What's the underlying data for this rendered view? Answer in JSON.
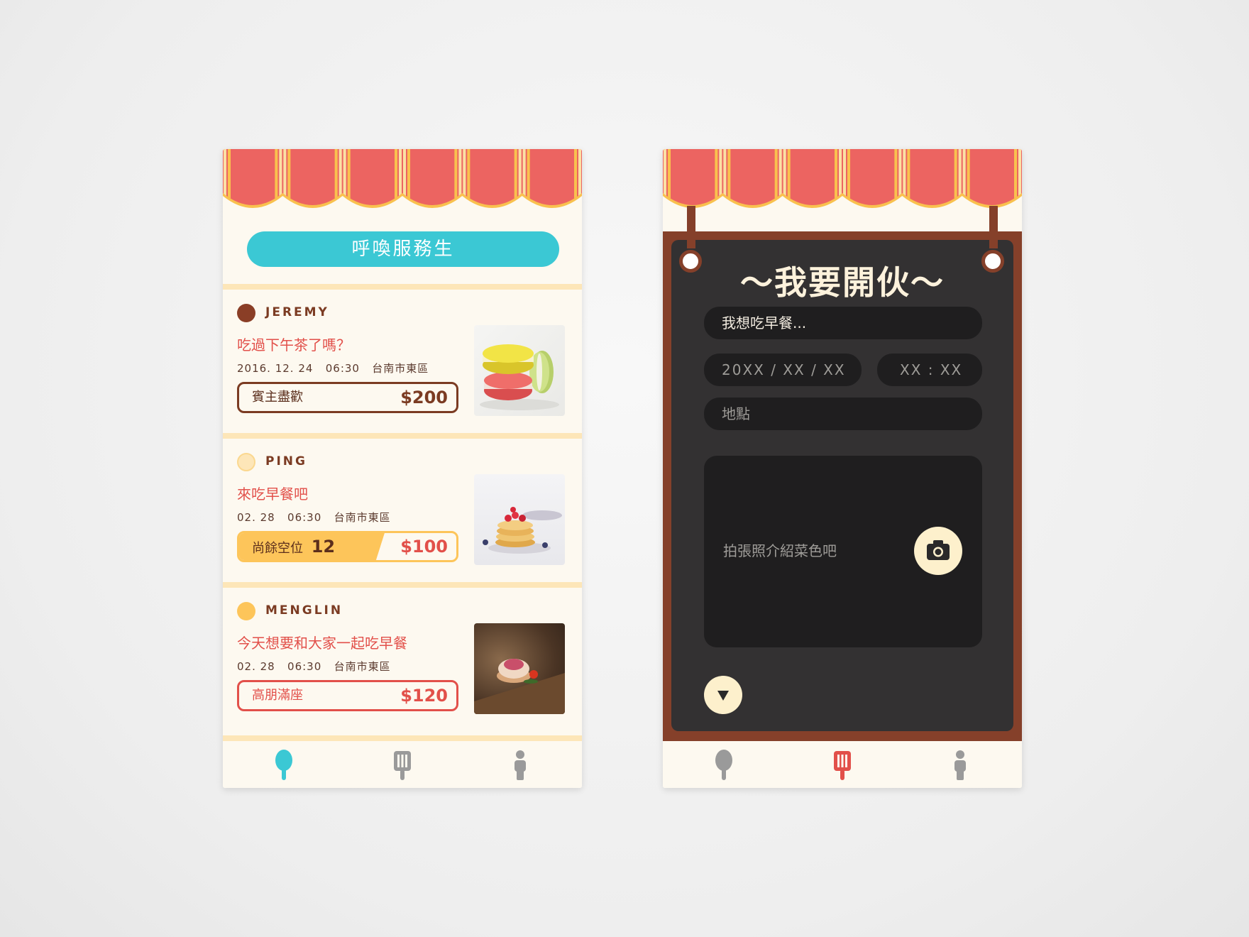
{
  "colors": {
    "awning_red": "#ec6461",
    "awning_stripe": "#fbe0a4",
    "awning_edge": "#f9c14e",
    "call_button": "#3bc8d4",
    "cream": "#fdf9f0",
    "brown": "#85402a",
    "board": "#333132",
    "accent_red": "#e2504a",
    "accent_yellow": "#fdc55a"
  },
  "left": {
    "call_button": "呼喚服務生",
    "posts": [
      {
        "user": "JEREMY",
        "avatar_color": "#8a3e26",
        "title": "吃過下午茶了嗎？",
        "date": "2016. 12. 24",
        "time": "06:30",
        "location": "台南市東區",
        "status": "賓主盡歡",
        "price": "$200",
        "photo": "macarons"
      },
      {
        "user": "PING",
        "avatar_color": "#fde6b8",
        "title": "來吃早餐吧",
        "date": "02. 28",
        "time": "06:30",
        "location": "台南市東區",
        "status": "尚餘空位",
        "seats": "12",
        "seats_fill": 0.65,
        "price": "$100",
        "photo": "pancakes"
      },
      {
        "user": "MENGLIN",
        "avatar_color": "#fdc55a",
        "title": "今天想要和大家一起吃早餐",
        "date": "02. 28",
        "time": "06:30",
        "location": "台南市東區",
        "status": "高朋滿座",
        "price": "$120",
        "photo": "tart"
      }
    ],
    "tabs": [
      {
        "icon": "spoon-icon",
        "active": true
      },
      {
        "icon": "spatula-icon",
        "active": false
      },
      {
        "icon": "person-icon",
        "active": false
      }
    ]
  },
  "right": {
    "title": "～我要開伙～",
    "event_name": "我想吃早餐...",
    "date_placeholder": "20XX / XX / XX",
    "time_placeholder": "XX : XX",
    "location_placeholder": "地點",
    "photo_prompt": "拍張照介紹菜色吧",
    "tabs": [
      {
        "icon": "spoon-icon",
        "active": false
      },
      {
        "icon": "spatula-icon",
        "active": true
      },
      {
        "icon": "person-icon",
        "active": false
      }
    ]
  }
}
